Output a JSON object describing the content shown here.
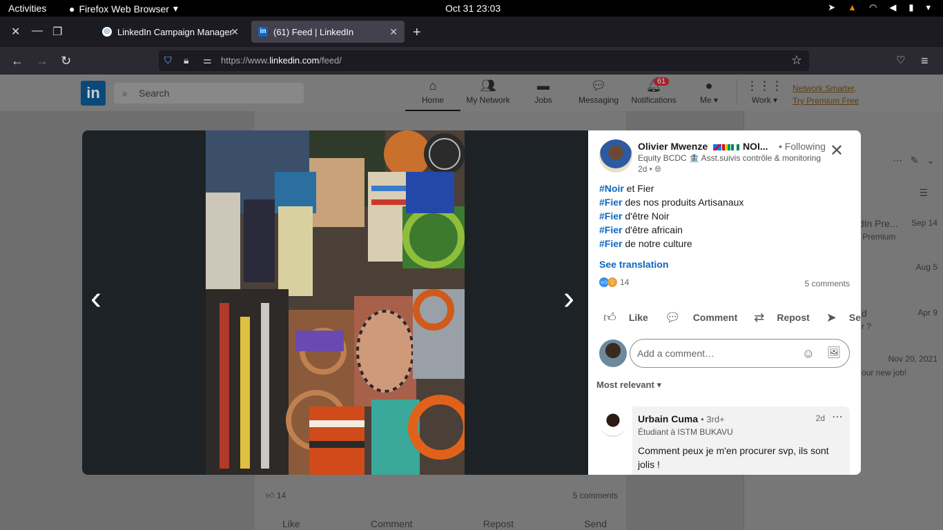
{
  "system": {
    "activities": "Activities",
    "app_name": "Firefox Web Browser",
    "clock": "Oct 31  23:03"
  },
  "browser": {
    "tabs": [
      {
        "title": "LinkedIn Campaign Manager"
      },
      {
        "title": "(61) Feed | LinkedIn"
      }
    ],
    "url_prefix": "https://www.",
    "url_domain": "linkedin.com",
    "url_suffix": "/feed/"
  },
  "linkedin": {
    "logo": "in",
    "search_placeholder": "Search",
    "nav": [
      {
        "label": "Home"
      },
      {
        "label": "My Network"
      },
      {
        "label": "Jobs"
      },
      {
        "label": "Messaging"
      },
      {
        "label": "Notifications",
        "badge": "61"
      },
      {
        "label": "Me"
      },
      {
        "label": "Work"
      }
    ],
    "premium_line1": "Network Smarter,",
    "premium_line2": "Try Premium Free",
    "feed_reaction_count": "14",
    "feed_comment_count": "5 comments",
    "feed_actions": [
      "Like",
      "Comment",
      "Repost",
      "Send"
    ],
    "right_rows": [
      {
        "text": "edIn Pre...",
        "date": "Sep 14",
        "sub": "ry Premium"
      },
      {
        "text": "",
        "date": "Aug 5",
        "sub": ""
      },
      {
        "text": "d",
        "date": "Apr 9",
        "sub": "r ?"
      },
      {
        "text": "",
        "date": "Nov 20, 2021",
        "sub": "our new job!"
      }
    ]
  },
  "post": {
    "author": "Olivier Mwenze",
    "author_suffix": "NOI...",
    "following": "• Following",
    "headline": "Equity BCDC 🏦 Asst.suivis contrôle & monitoring",
    "meta": "2d •",
    "lines": [
      {
        "tag": "#Noir",
        "text": " et Fier"
      },
      {
        "tag": "#Fier",
        "text": " des nos produits Artisanaux"
      },
      {
        "tag": "#Fier",
        "text": " d'être Noir"
      },
      {
        "tag": "#Fier",
        "text": " d'être africain"
      },
      {
        "tag": "#Fier",
        "text": " de notre culture"
      }
    ],
    "see_translation": "See translation",
    "reaction_count": "14",
    "comment_count": "5 comments",
    "actions": {
      "like": "Like",
      "comment": "Comment",
      "repost": "Repost",
      "send": "Send"
    },
    "comment_placeholder": "Add a comment…",
    "sort_label": "Most relevant"
  },
  "comment": {
    "author": "Urbain Cuma",
    "degree": "• 3rd+",
    "headline": "Étudiant à ISTM BUKAVU",
    "time": "2d",
    "text": "Comment peux je m'en procurer svp, ils sont jolis !"
  },
  "colors": {
    "accent": "#0a66c2",
    "viewer_bg": "#1d2226",
    "firefox_tab_bg": "#1c1b22"
  }
}
